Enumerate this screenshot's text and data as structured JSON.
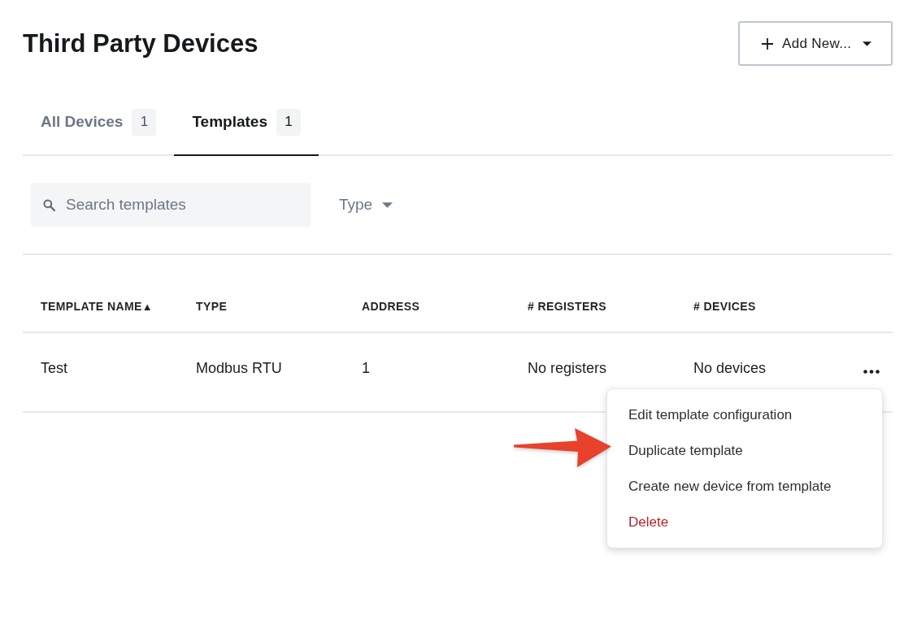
{
  "page": {
    "title": "Third Party Devices"
  },
  "add_button": {
    "label": "Add New..."
  },
  "tabs": [
    {
      "label": "All Devices",
      "count": "1",
      "selected": false
    },
    {
      "label": "Templates",
      "count": "1",
      "selected": true
    }
  ],
  "search": {
    "placeholder": "Search templates"
  },
  "type_filter": {
    "label": "Type"
  },
  "table": {
    "columns": [
      {
        "label": "TEMPLATE NAME",
        "sort": "▲"
      },
      {
        "label": "TYPE"
      },
      {
        "label": "ADDRESS"
      },
      {
        "label": "# REGISTERS"
      },
      {
        "label": "# DEVICES"
      }
    ],
    "rows": [
      {
        "cells": [
          "Test",
          "Modbus RTU",
          "1",
          "No registers",
          "No devices"
        ]
      }
    ]
  },
  "context_menu": {
    "items": [
      {
        "label": "Edit template configuration",
        "kind": "action"
      },
      {
        "label": "Duplicate template",
        "kind": "action"
      },
      {
        "label": "Create new device from template",
        "kind": "action"
      },
      {
        "label": "Delete",
        "kind": "danger"
      }
    ]
  }
}
